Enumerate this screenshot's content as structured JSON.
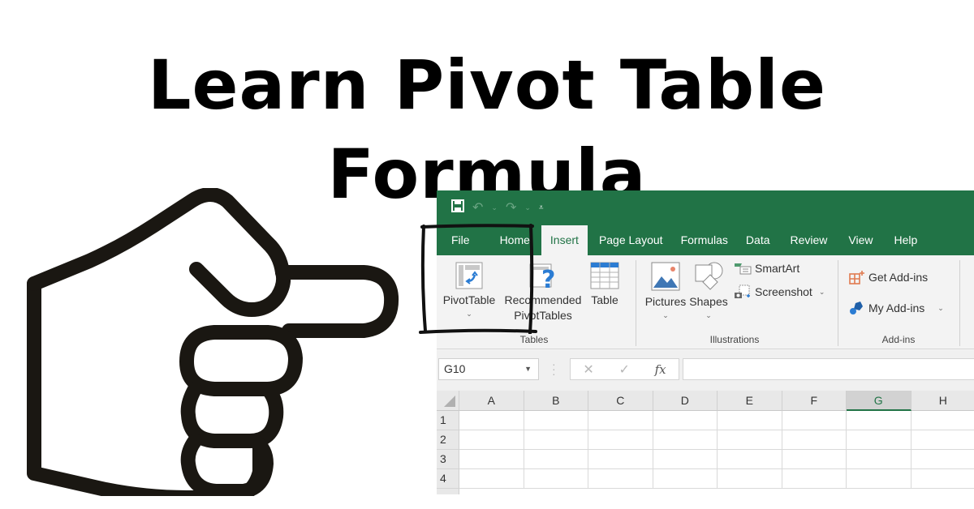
{
  "headline": "Learn Pivot Table Formula",
  "excel": {
    "colors": {
      "brand_green": "#217346",
      "ribbon_bg": "#f3f3f3"
    },
    "quick_access": {
      "save_icon": "save-icon",
      "undo_icon": "undo-icon",
      "redo_icon": "redo-icon",
      "customize_icon": "customize-qat-icon"
    },
    "tabs": [
      {
        "label": "File"
      },
      {
        "label": "Home"
      },
      {
        "label": "Insert",
        "active": true
      },
      {
        "label": "Page Layout"
      },
      {
        "label": "Formulas"
      },
      {
        "label": "Data"
      },
      {
        "label": "Review"
      },
      {
        "label": "View"
      },
      {
        "label": "Help"
      }
    ],
    "ribbon": {
      "groups": {
        "tables": {
          "label": "Tables",
          "pivottable": "PivotTable",
          "recommended_line1": "Recommended",
          "recommended_line2": "PivotTables",
          "table": "Table"
        },
        "illustrations": {
          "label": "Illustrations",
          "pictures": "Pictures",
          "shapes": "Shapes",
          "smartart": "SmartArt",
          "screenshot": "Screenshot"
        },
        "addins": {
          "label": "Add-ins",
          "get_addins": "Get Add-ins",
          "my_addins": "My Add-ins"
        }
      },
      "dropdown_glyph": "⌄"
    },
    "formula_bar": {
      "name_box": "G10",
      "cancel_glyph": "✕",
      "enter_glyph": "✓",
      "fx_label": "fx",
      "formula_value": ""
    },
    "sheet": {
      "columns": [
        "A",
        "B",
        "C",
        "D",
        "E",
        "F",
        "G",
        "H"
      ],
      "selected_column": "G",
      "rows": [
        "1",
        "2",
        "3",
        "4"
      ]
    }
  }
}
